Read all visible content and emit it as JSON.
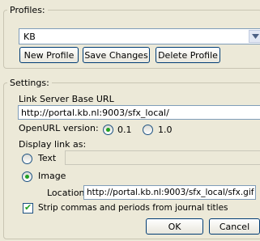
{
  "profiles": {
    "legend": "Profiles:",
    "selected": "KB",
    "new_profile_label": "New Profile",
    "save_changes_label": "Save Changes",
    "delete_profile_label": "Delete Profile"
  },
  "settings": {
    "legend": "Settings:",
    "link_server_label": "Link Server Base URL",
    "link_server_value": "http://portal.kb.nl:9003/sfx_local/",
    "openurl_label": "OpenURL version:",
    "openurl_options": [
      "0.1",
      "1.0"
    ],
    "openurl_selected": "0.1",
    "display_link_label": "Display link as:",
    "text_option_label": "Text",
    "text_value": "",
    "image_option_label": "Image",
    "display_selected": "Image",
    "location_label": "Location",
    "location_value": "http://portal.kb.nl:9003/sfx_local/sfx.gif",
    "strip_label": "Strip commas and periods from journal titles",
    "strip_checked": true
  },
  "dialog": {
    "ok_label": "OK",
    "cancel_label": "Cancel"
  },
  "colors": {
    "background": "#ece9d8",
    "radio_checked": "#21a121",
    "input_border": "#7f9db9"
  }
}
